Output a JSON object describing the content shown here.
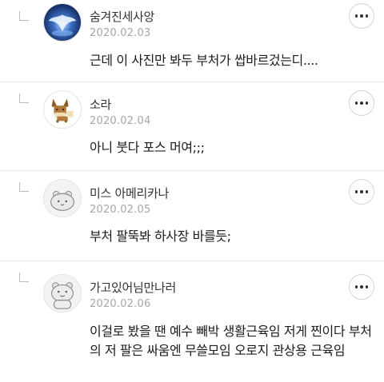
{
  "comments": [
    {
      "author": "숨겨진세사앙",
      "date": "2020.02.03",
      "text": "근데 이 사진만 봐두 부처가 쌉바르겄는디....",
      "avatar_icon": "lugia-avatar-icon"
    },
    {
      "author": "소라",
      "date": "2020.02.04",
      "text": "아니 붓다 포스 머여;;;",
      "avatar_icon": "eevee-avatar-icon"
    },
    {
      "author": "미스 아메리카나",
      "date": "2020.02.05",
      "text": "부처 팔뚝봐 하사장 바를듯;",
      "avatar_icon": "default-hamster-avatar-icon"
    },
    {
      "author": "가고있어님만나러",
      "date": "2020.02.06",
      "text": "이걸로 봤을 땐 예수 빼박 생활근육임 저게 찐이다 부처의 저 팔은 싸움엔 무쓸모임 오로지 관상용 근육임",
      "avatar_icon": "default-hamster-avatar-icon"
    }
  ],
  "icons": {
    "reply": "reply-arrow-icon",
    "more": "more-options-icon"
  }
}
